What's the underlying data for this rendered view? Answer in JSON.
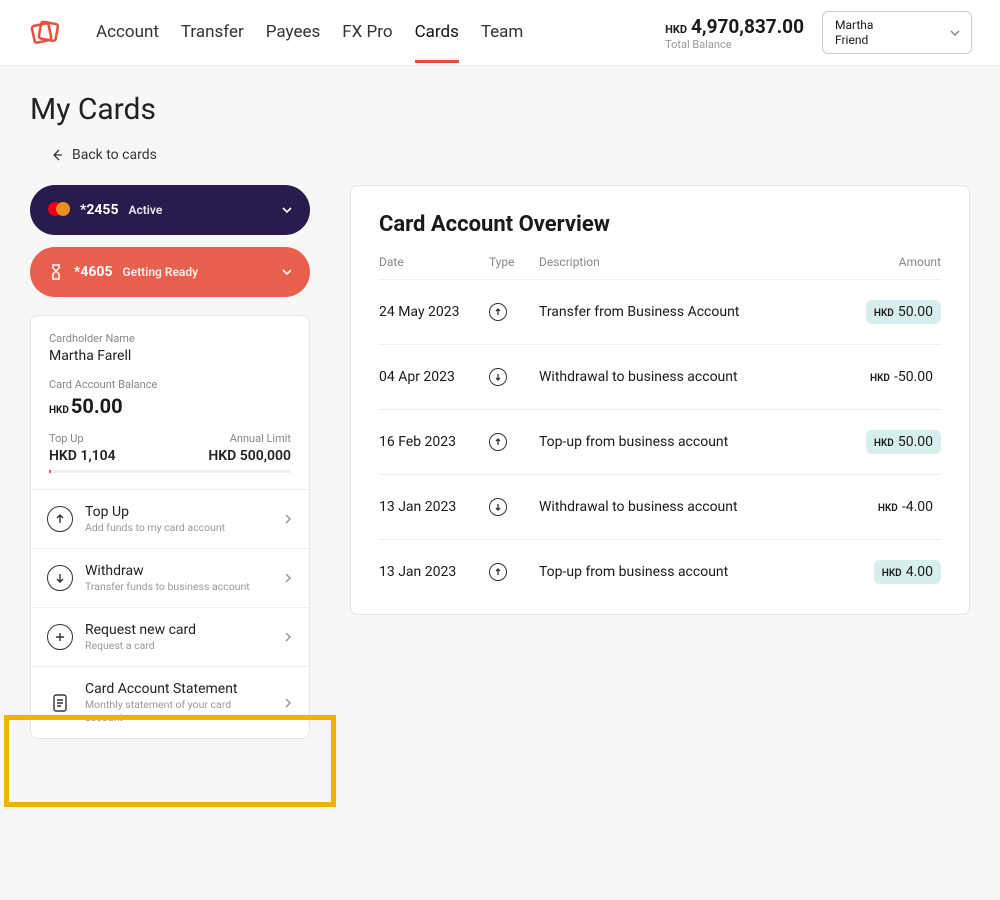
{
  "header": {
    "nav": [
      "Account",
      "Transfer",
      "Payees",
      "FX Pro",
      "Cards",
      "Team"
    ],
    "active_nav_index": 4,
    "balance_ccy": "HKD",
    "balance_amount": "4,970,837.00",
    "balance_label": "Total Balance",
    "user_line1": "Martha",
    "user_line2": "Friend"
  },
  "page": {
    "title": "My Cards",
    "back_label": "Back to cards"
  },
  "cards": [
    {
      "last4": "*2455",
      "status": "Active",
      "variant": "dark"
    },
    {
      "last4": "*4605",
      "status": "Getting Ready",
      "variant": "red"
    }
  ],
  "cardholder": {
    "name_label": "Cardholder Name",
    "name": "Martha Farell",
    "balance_label": "Card Account Balance",
    "balance_ccy": "HKD",
    "balance": "50.00",
    "topup_label": "Top Up",
    "topup_value": "HKD 1,104",
    "limit_label": "Annual Limit",
    "limit_value": "HKD 500,000"
  },
  "actions": {
    "topup": {
      "title": "Top Up",
      "sub": "Add funds to my card account"
    },
    "withdraw": {
      "title": "Withdraw",
      "sub": "Transfer funds to business account"
    },
    "request": {
      "title": "Request new card",
      "sub": "Request a card"
    },
    "stmt": {
      "title": "Card Account Statement",
      "sub": "Monthly statement of your card account"
    }
  },
  "overview": {
    "title": "Card Account Overview",
    "columns": {
      "date": "Date",
      "type": "Type",
      "desc": "Description",
      "amount": "Amount"
    },
    "rows": [
      {
        "date": "24 May 2023",
        "dir": "up",
        "desc": "Transfer from Business Account",
        "ccy": "HKD",
        "amount": "50.00",
        "positive": true
      },
      {
        "date": "04 Apr 2023",
        "dir": "down",
        "desc": "Withdrawal to business account",
        "ccy": "HKD",
        "amount": "-50.00",
        "positive": false
      },
      {
        "date": "16 Feb 2023",
        "dir": "up",
        "desc": "Top-up from business account",
        "ccy": "HKD",
        "amount": "50.00",
        "positive": true
      },
      {
        "date": "13 Jan 2023",
        "dir": "down",
        "desc": "Withdrawal to business account",
        "ccy": "HKD",
        "amount": "-4.00",
        "positive": false
      },
      {
        "date": "13 Jan 2023",
        "dir": "up",
        "desc": "Top-up from business account",
        "ccy": "HKD",
        "amount": "4.00",
        "positive": true
      }
    ]
  }
}
